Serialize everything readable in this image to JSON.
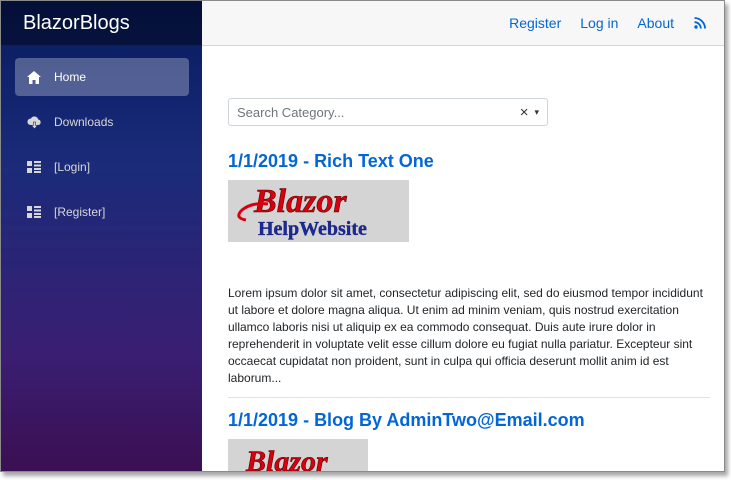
{
  "sidebar": {
    "brand": "BlazorBlogs",
    "items": [
      {
        "label": "Home",
        "icon": "home-icon"
      },
      {
        "label": "Downloads",
        "icon": "cloud-download-icon"
      },
      {
        "label": "[Login]",
        "icon": "list-icon"
      },
      {
        "label": "[Register]",
        "icon": "list-icon"
      }
    ]
  },
  "topbar": {
    "links": [
      "Register",
      "Log in",
      "About"
    ],
    "rss_icon": "rss-icon"
  },
  "search": {
    "placeholder": "Search Category...",
    "clear": "×",
    "caret": "▾"
  },
  "posts": [
    {
      "title": "1/1/2019 - Rich Text One",
      "logo_text_1": "Blazor",
      "logo_text_2": "HelpWebsite",
      "body": "Lorem ipsum dolor sit amet, consectetur adipiscing elit, sed do eiusmod tempor incididunt ut labore et dolore magna aliqua. Ut enim ad minim veniam, quis nostrud exercitation ullamco laboris nisi ut aliquip ex ea commodo consequat. Duis aute irure dolor in reprehenderit in voluptate velit esse cillum dolore eu fugiat nulla pariatur. Excepteur sint occaecat cupidatat non proident, sunt in culpa qui officia deserunt mollit anim id est laborum..."
    },
    {
      "title": "1/1/2019 - Blog By AdminTwo@Email.com",
      "logo_text_1": "Blazor"
    }
  ],
  "colors": {
    "link": "#0366d6",
    "logo_red": "#d6000f",
    "logo_blue": "#1a2a9c"
  }
}
